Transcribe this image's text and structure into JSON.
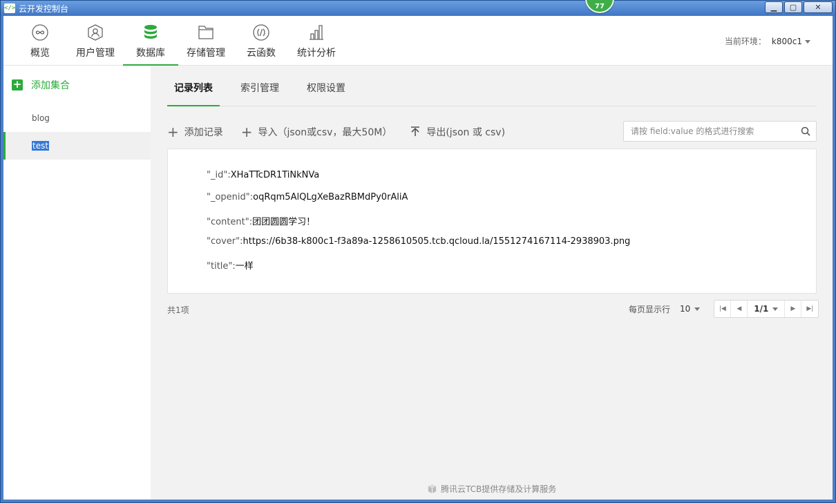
{
  "window": {
    "title": "云开发控制台",
    "badge": "77",
    "buttons": {
      "minimize": "▁",
      "maximize": "▢",
      "close": "✕"
    }
  },
  "nav": {
    "items": [
      {
        "label": "概览",
        "icon": "infinity-icon"
      },
      {
        "label": "用户管理",
        "icon": "user-icon"
      },
      {
        "label": "数据库",
        "icon": "database-icon"
      },
      {
        "label": "存储管理",
        "icon": "folder-icon"
      },
      {
        "label": "云函数",
        "icon": "function-icon"
      },
      {
        "label": "统计分析",
        "icon": "bar-chart-icon"
      }
    ],
    "active": "数据库",
    "env_label": "当前环境：",
    "env_value": "k800c1"
  },
  "sidebar": {
    "add_label": "添加集合",
    "collections": [
      "blog",
      "test"
    ],
    "selected": "test"
  },
  "tabs": [
    "记录列表",
    "索引管理",
    "权限设置"
  ],
  "toolbar": {
    "add_record": "添加记录",
    "import": "导入（json或csv，最大50M）",
    "export": "导出(json 或 csv)",
    "search_placeholder": "请按 field:value 的格式进行搜索"
  },
  "record": [
    {
      "key": "\"_id\":",
      "value": "XHaTTcDR1TiNkNVa"
    },
    {
      "key": "\"_openid\":",
      "value": "oqRqm5AlQLgXeBazRBMdPy0rAliA"
    },
    {
      "key": "\"content\":",
      "value": "团团圆圆学习！"
    },
    {
      "key": "\"cover\":",
      "value": "https://6b38-k800c1-f3a89a-1258610505.tcb.qcloud.la/1551274167114-2938903.png"
    },
    {
      "key": "\"title\":",
      "value": "一样"
    }
  ],
  "pagination": {
    "total": "共1项",
    "per_page_label": "每页显示行",
    "per_page": "10",
    "page": "1/1"
  },
  "footer": "腾讯云TCB提供存储及计算服务",
  "colors": {
    "accent": "#2bab3a",
    "selection": "#3478d5"
  }
}
